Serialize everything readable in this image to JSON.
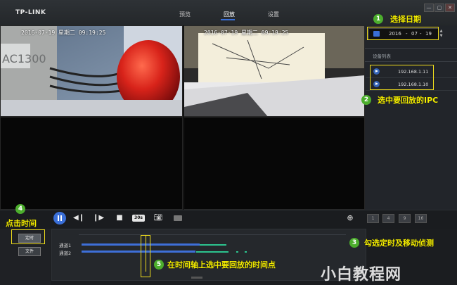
{
  "app": {
    "logo": "TP-LINK"
  },
  "nav": [
    {
      "label": "预览",
      "active": false
    },
    {
      "label": "回放",
      "active": true
    },
    {
      "label": "设置",
      "active": false
    }
  ],
  "window": {
    "minimize": "—",
    "restore": "▢",
    "close": "✕"
  },
  "video": {
    "cells": [
      {
        "timestamp": "2016-07-19 星期二 09:19:25"
      },
      {
        "timestamp": "2016-07-19 星期二 09:19:25"
      }
    ]
  },
  "sidebar": {
    "date": {
      "year": "2016",
      "month": "07",
      "day": "19"
    },
    "device_list_title": "设备列表",
    "devices": [
      "192.168.1.11",
      "192.168.1.10"
    ]
  },
  "controls": {
    "speed_label": "30s",
    "split_options": [
      "1",
      "4",
      "9",
      "16"
    ]
  },
  "left_panel": {
    "timed_button": "定时",
    "file_button": "文件"
  },
  "timeline": {
    "channels": [
      "通道1",
      "通道2"
    ]
  },
  "annotations": [
    {
      "num": "1",
      "text": "选择日期"
    },
    {
      "num": "2",
      "text": "选中要回放的IPC"
    },
    {
      "num": "3",
      "text": "勾选定时及移动侦测"
    },
    {
      "num": "4",
      "text": "点击时间"
    },
    {
      "num": "5",
      "text": "在时间轴上选中要回放的时间点"
    }
  ],
  "watermark": "小白教程网",
  "colors": {
    "accent": "#3a6fd8",
    "motion": "#2cc38e",
    "highlight": "#f2df1c",
    "annotation": "#f5ee00",
    "badge": "#4cae2d"
  }
}
